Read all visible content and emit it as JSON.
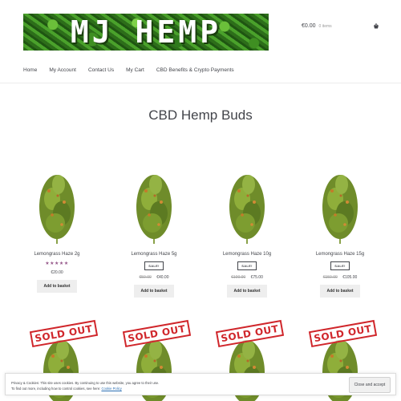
{
  "header": {
    "logo_text": "MJ HEMP",
    "cart_amount": "€0.00",
    "cart_count": "0 items"
  },
  "nav": {
    "items": [
      {
        "label": "Home"
      },
      {
        "label": "My Account"
      },
      {
        "label": "Contact Us"
      },
      {
        "label": "My Cart"
      },
      {
        "label": "CBD Benefits & Crypto Payments"
      }
    ]
  },
  "page": {
    "title": "CBD Hemp Buds"
  },
  "products": [
    {
      "name": "Lemongrass Haze 2g",
      "rating": 5,
      "stars": "★★★★★",
      "sale": "",
      "old_price": "",
      "price": "€20.00",
      "button": "Add to basket"
    },
    {
      "name": "Lemongrass Haze 5g",
      "rating": 0,
      "stars": "",
      "sale": "SALE!",
      "old_price": "€50.00",
      "price": "€40.00",
      "button": "Add to basket"
    },
    {
      "name": "Lemongrass Haze 10g",
      "rating": 0,
      "stars": "",
      "sale": "SALE!",
      "old_price": "€100.00",
      "price": "€75.00",
      "button": "Add to basket"
    },
    {
      "name": "Lemongrass Haze 15g",
      "rating": 0,
      "stars": "",
      "sale": "SALE!",
      "old_price": "€150.00",
      "price": "€105.00",
      "button": "Add to basket"
    }
  ],
  "soldout": {
    "label": "SOLD OUT"
  },
  "cookie": {
    "line1": "Privacy & Cookies: This site uses cookies. By continuing to use this website, you agree to their use.",
    "line2": "To find out more, including how to control cookies, see here:",
    "link": "Cookie Policy",
    "button": "Close and accept"
  },
  "colors": {
    "accent": "#96588a",
    "sold_out_red": "#d0262b",
    "logo_green": "#4aa12b"
  },
  "icons": {
    "cart": "basket-icon"
  }
}
